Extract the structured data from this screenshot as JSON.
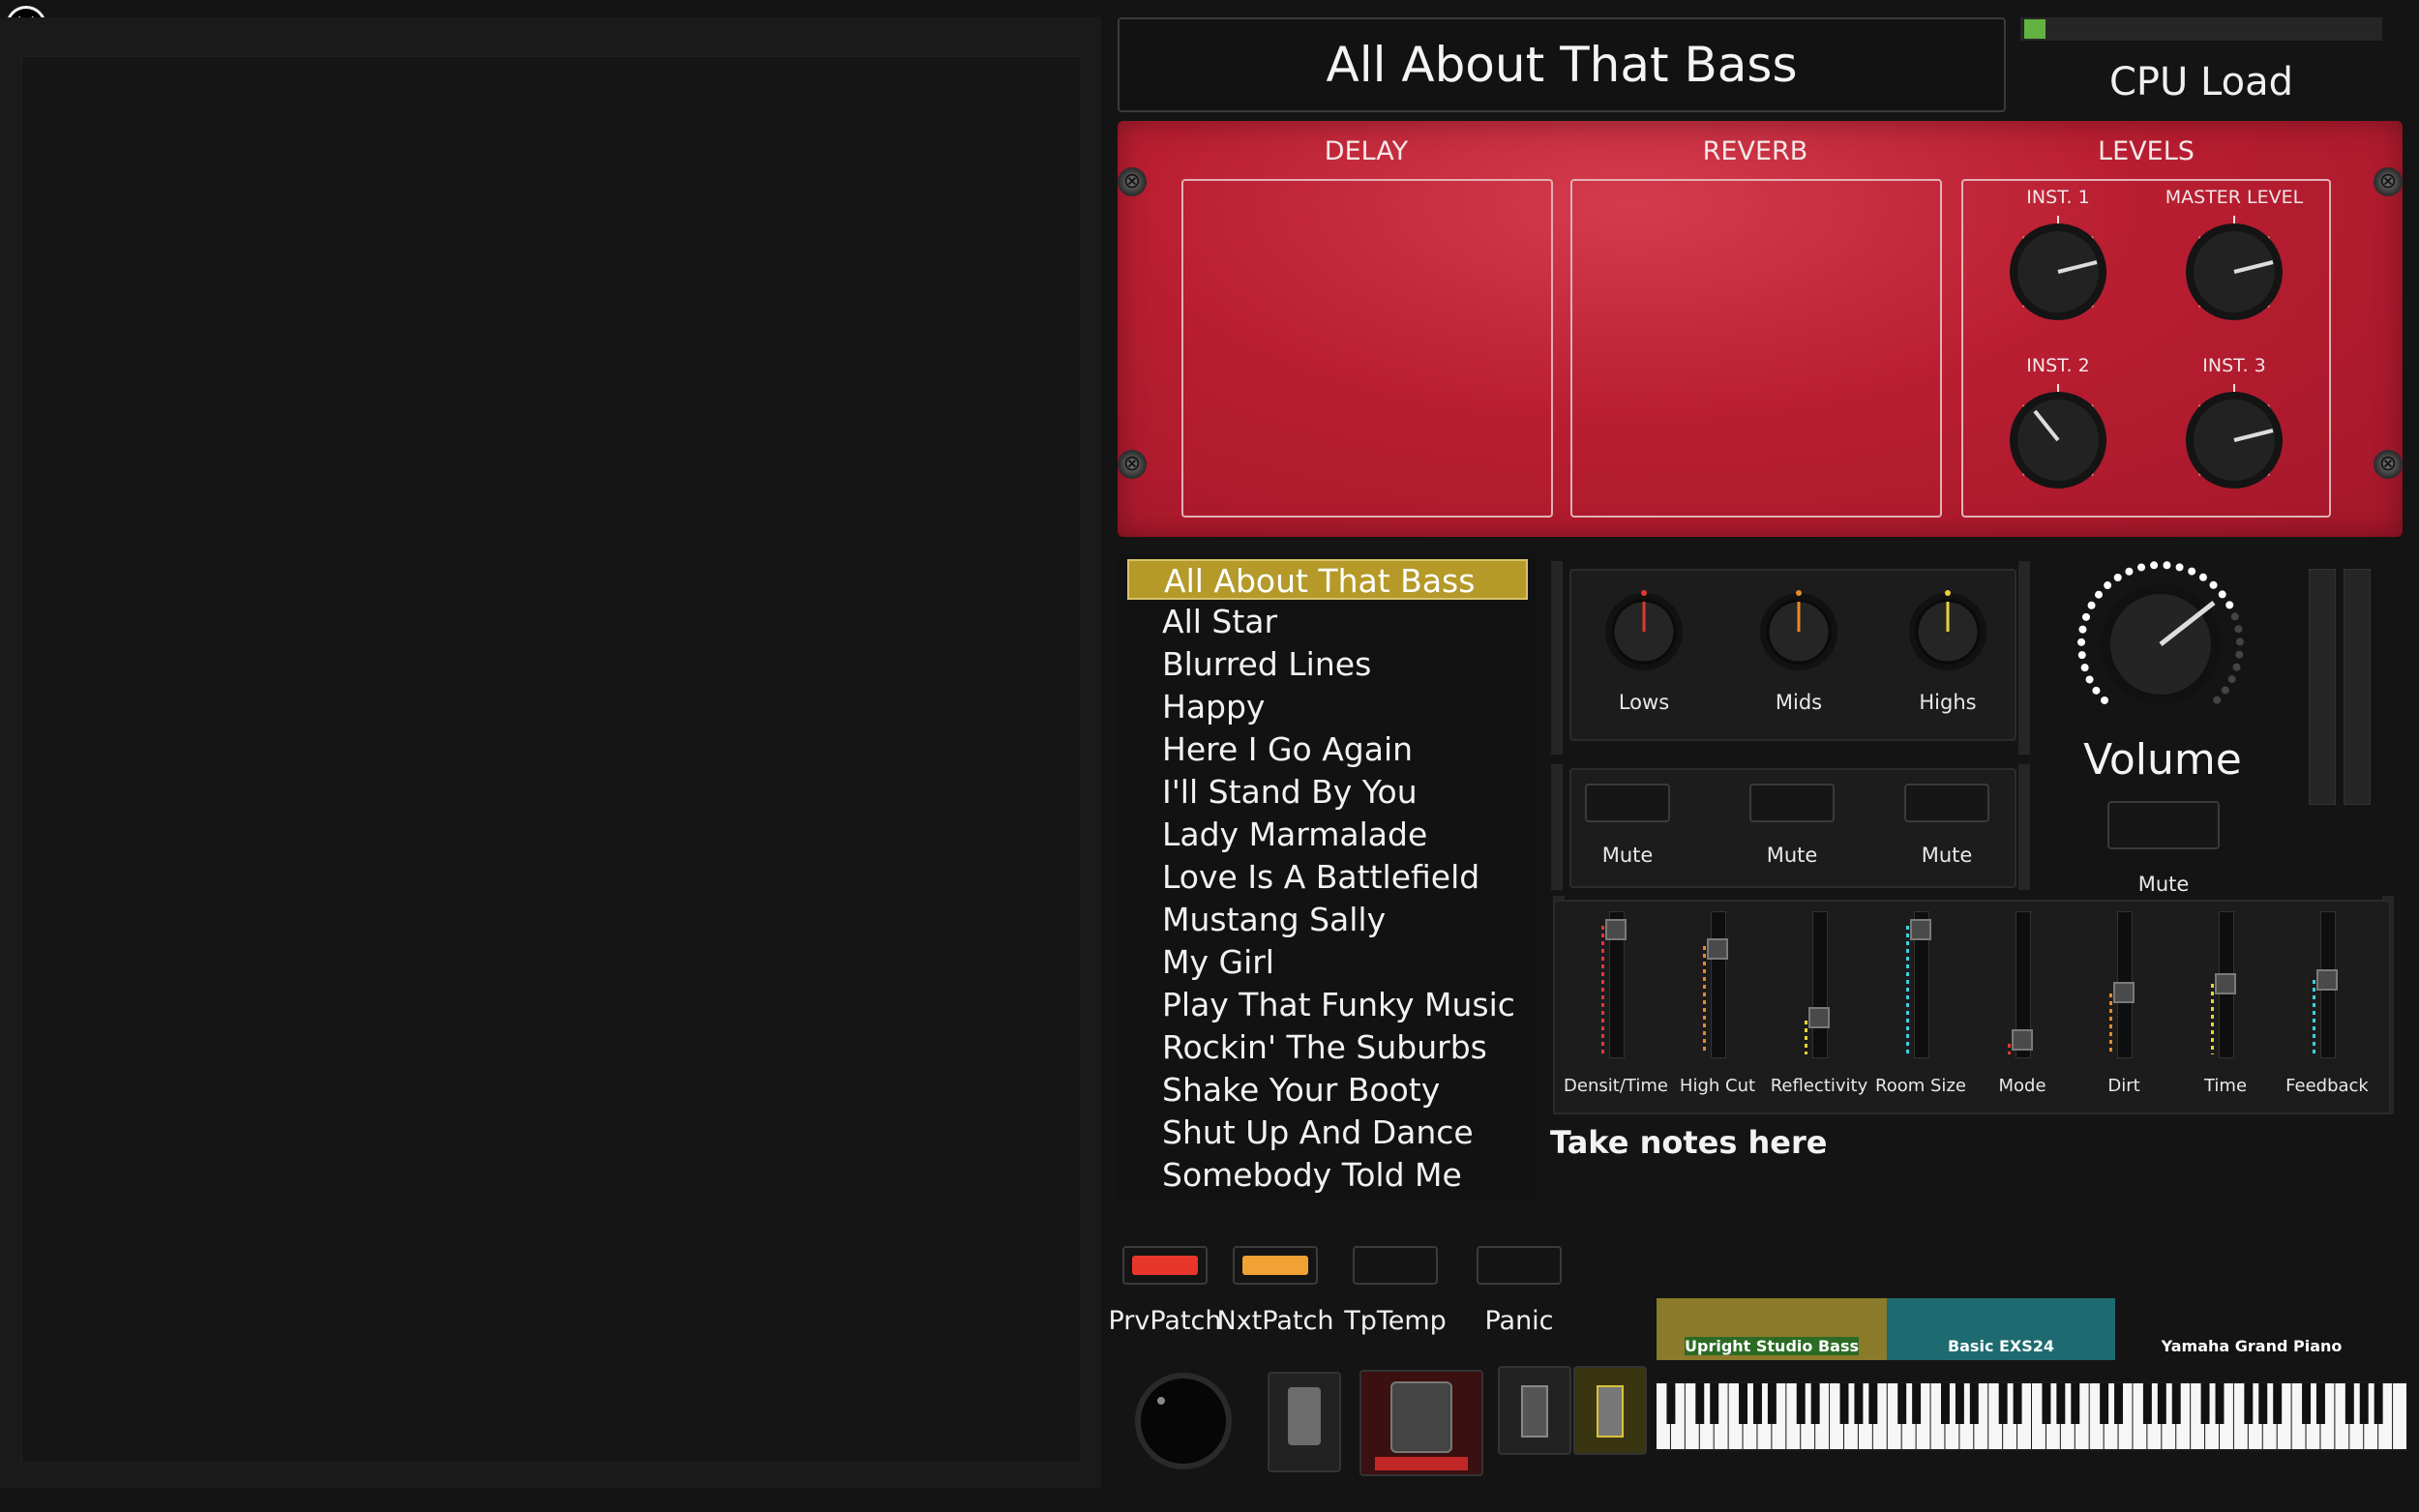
{
  "app": {
    "close_icon": "close-circle-icon",
    "title": "All About That Bass",
    "cpu_label": "CPU Load",
    "cpu_load_fraction": 0.06,
    "accent_color": "#b59a2a"
  },
  "fx": {
    "delay_label": "DELAY",
    "reverb_label": "REVERB",
    "levels_label": "LEVELS",
    "knobs": [
      {
        "label": "INST. 1"
      },
      {
        "label": "MASTER LEVEL"
      },
      {
        "label": "INST. 2"
      },
      {
        "label": "INST. 3"
      }
    ]
  },
  "playlist": {
    "songs": [
      "All About That Bass",
      "All Star",
      "Blurred Lines",
      "Happy",
      "Here I Go Again",
      "I'll Stand By You",
      "Lady Marmalade",
      "Love Is A Battlefield",
      "Mustang Sally",
      "My Girl",
      "Play That Funky Music",
      "Rockin' The Suburbs",
      "Shake Your Booty",
      "Shut Up And Dance",
      "Somebody Told Me"
    ],
    "selected_index": 0
  },
  "eq": {
    "lows": "Lows",
    "mids": "Mids",
    "highs": "Highs",
    "mute1": "Mute",
    "mute2": "Mute",
    "mute3": "Mute"
  },
  "volume": {
    "label": "Volume",
    "mute": "Mute"
  },
  "faders": [
    {
      "label": "Densit/Time",
      "level": 0.95,
      "color": "#e0392f"
    },
    {
      "label": "High Cut",
      "level": 0.8,
      "color": "#e58a2a"
    },
    {
      "label": "Reflectivity",
      "level": 0.25,
      "color": "#e7d23a"
    },
    {
      "label": "Room Size",
      "level": 0.95,
      "color": "#3fd0d8"
    },
    {
      "label": "Mode",
      "level": 0.08,
      "color": "#e0392f"
    },
    {
      "label": "Dirt",
      "level": 0.45,
      "color": "#e58a2a"
    },
    {
      "label": "Time",
      "level": 0.52,
      "color": "#e7d23a"
    },
    {
      "label": "Feedback",
      "level": 0.55,
      "color": "#3fd0d8"
    }
  ],
  "notes": {
    "placeholder": "Take notes here"
  },
  "controls": {
    "prv": "PrvPatch",
    "nxt": "NxtPatch",
    "tap": "TpTemp",
    "panic": "Panic",
    "prv_color": "#e8362b",
    "nxt_color": "#f0a234"
  },
  "instruments": [
    {
      "name": "Upright Studio Bass",
      "color": "#8a7a2a"
    },
    {
      "name": "Basic EXS24",
      "color": "#2c6b24"
    },
    {
      "name": "Yamaha Grand Piano",
      "color": "#1d6b70"
    }
  ]
}
